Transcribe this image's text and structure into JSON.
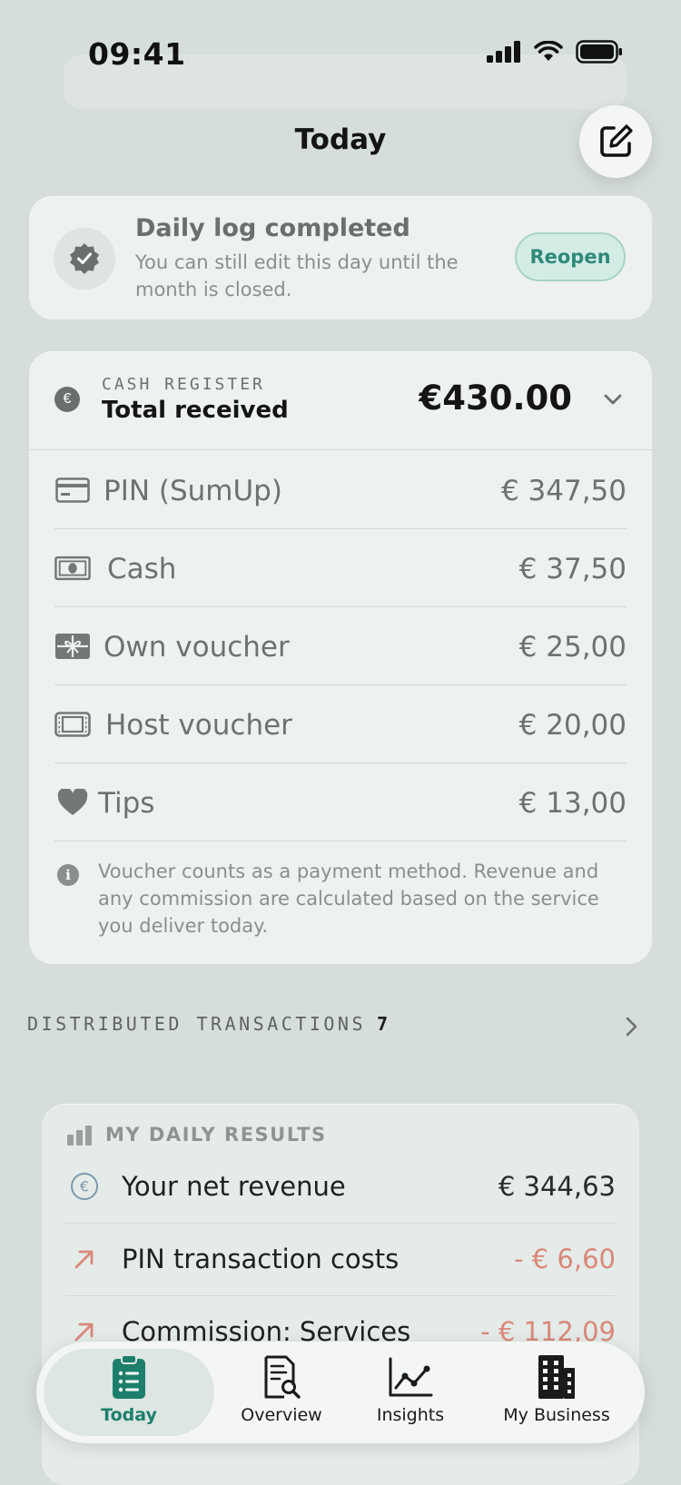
{
  "status_bar": {
    "time": "09:41"
  },
  "header": {
    "title": "Today"
  },
  "completed_card": {
    "title": "Daily log completed",
    "subtitle": "You can still edit this day until the month is closed.",
    "reopen_label": "Reopen"
  },
  "cash_register": {
    "eyebrow": "CASH REGISTER",
    "label": "Total received",
    "total": "€430.00",
    "methods": [
      {
        "icon": "card-icon",
        "label": "PIN (SumUp)",
        "value": "€ 347,50"
      },
      {
        "icon": "banknote-icon",
        "label": "Cash",
        "value": "€ 37,50"
      },
      {
        "icon": "gift-icon",
        "label": "Own voucher",
        "value": "€ 25,00"
      },
      {
        "icon": "ticket-icon",
        "label": "Host voucher",
        "value": "€ 20,00"
      },
      {
        "icon": "heart-icon",
        "label": "Tips",
        "value": "€ 13,00"
      }
    ],
    "info": "Voucher counts as a payment method. Revenue and any commission are calculated based on the service you deliver today."
  },
  "distributed": {
    "label": "DISTRIBUTED TRANSACTIONS",
    "count": "7"
  },
  "daily_results": {
    "title": "MY DAILY RESULTS",
    "rows": [
      {
        "icon": "euro-circle-icon",
        "label": "Your net revenue",
        "value": "€ 344,63"
      },
      {
        "icon": "arrow-up-right-icon",
        "label": "PIN transaction costs",
        "value": "- € 6,60"
      },
      {
        "icon": "arrow-up-right-icon",
        "label": "Commission: Services",
        "value": "- € 112,09"
      }
    ]
  },
  "tabbar": {
    "tabs": [
      {
        "label": "Today",
        "icon": "clipboard-list-icon",
        "active": true
      },
      {
        "label": "Overview",
        "icon": "document-search-icon",
        "active": false
      },
      {
        "label": "Insights",
        "icon": "line-chart-icon",
        "active": false
      },
      {
        "label": "My Business",
        "icon": "building-icon",
        "active": false
      }
    ]
  },
  "colors": {
    "accent": "#1d7f6b",
    "negative": "#d9887a",
    "background": "#d6dedb"
  }
}
